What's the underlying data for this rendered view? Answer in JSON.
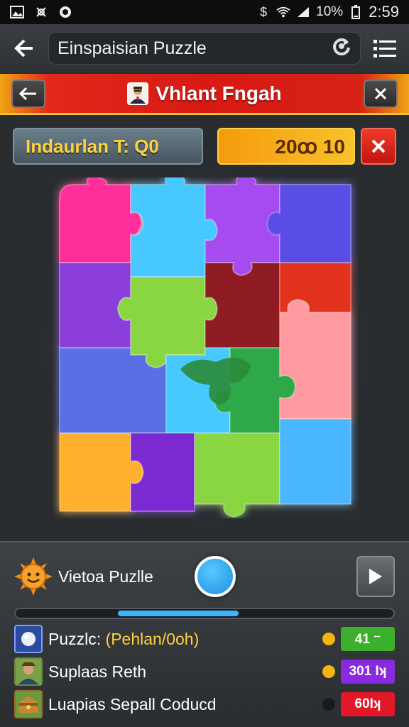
{
  "status_bar": {
    "battery": "10%",
    "time": "2:59",
    "icons": [
      "gallery-icon",
      "fingerprint-icon",
      "circle-app-icon",
      "dollar-icon",
      "wifi-icon",
      "signal-icon"
    ]
  },
  "app_bar": {
    "title": "Einspaisian Puzzle",
    "icons": [
      "back-arrow-icon",
      "refresh-icon",
      "list-menu-icon"
    ]
  },
  "game_header": {
    "title": "Vhlant Fngah"
  },
  "score_row": {
    "timer_text": "Indaurlan T: Q0",
    "score_text": "20ꝏ 10"
  },
  "colors": {
    "header_red": "#d81a14",
    "accent_orange": "#f59b0d",
    "accent_blue": "#3ab4ff",
    "timer_yellow": "#ffd23a"
  },
  "bottom_panel": {
    "label": "Vietoa Puzlle",
    "progress": 0.58
  },
  "players": [
    {
      "name": "Puzzlc: ",
      "highlight": "(Pehlan/0oh)",
      "badge": "41 ⁻",
      "badge_color": "#3cb02a",
      "dot_color": "#f5b50c"
    },
    {
      "name": "Suplaas Reth",
      "highlight": "",
      "badge": "301 Iʞ",
      "badge_color": "#8a2ae0",
      "dot_color": "#f5b50c"
    },
    {
      "name": "Luapias Sepall Coducd",
      "highlight": "",
      "badge": "60Iʞ",
      "badge_color": "#e21828",
      "dot_color": "#1a1a1a"
    }
  ]
}
